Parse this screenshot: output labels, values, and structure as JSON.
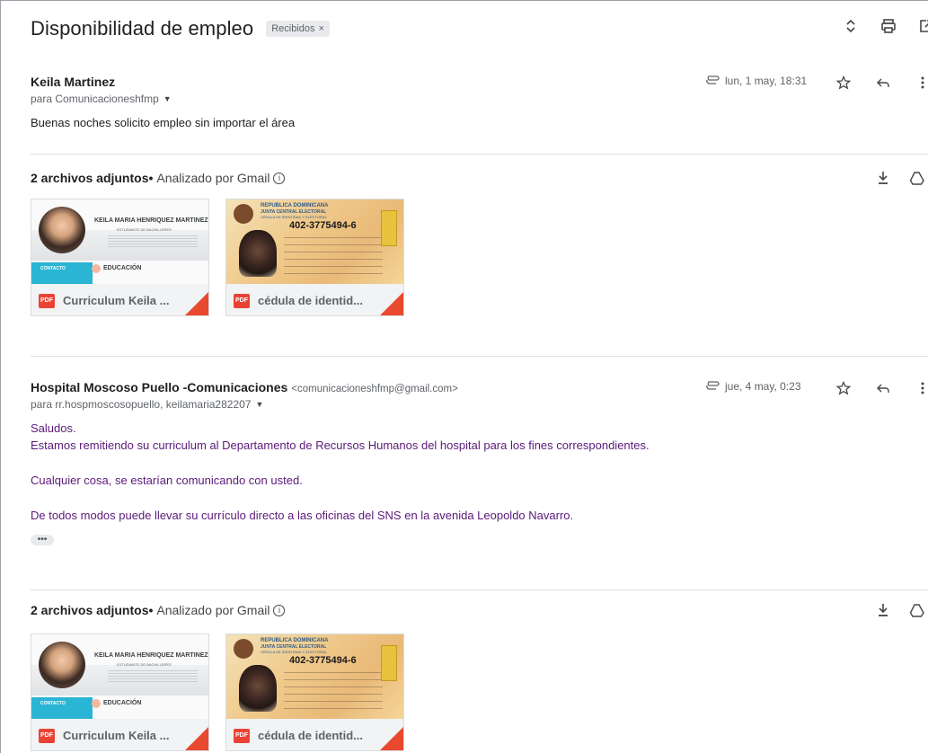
{
  "subject": "Disponibilidad de empleo",
  "label_chip": "Recibidos",
  "label_chip_close": "×",
  "top_icons": [
    "expand-collapse-icon",
    "print-icon",
    "open-new-window-icon"
  ],
  "messages": [
    {
      "sender": "Keila Martinez",
      "sender_email": "",
      "to": "para Comunicacioneshfmp",
      "date": "lun, 1 may, 18:31",
      "body": [
        "Buenas noches solicito empleo sin importar el área"
      ],
      "attachments_title": "2 archivos adjuntos",
      "attachments_note": "Analizado por Gmail",
      "attachments": [
        {
          "name": "Curriculum Keila ...",
          "type": "PDF"
        },
        {
          "name": "cédula de identid...",
          "type": "PDF"
        }
      ]
    },
    {
      "sender": "Hospital Moscoso Puello -Comunicaciones",
      "sender_email": "<comunicacioneshfmp@gmail.com>",
      "to": "para rr.hospmoscosopuello, keilamaria282207",
      "date": "jue, 4 may, 0:23",
      "body": [
        "Saludos.",
        "Estamos remitiendo su curriculum al Departamento de Recursos Humanos del hospital para los fines correspondientes.",
        "Cualquier cosa, se estarían comunicando con usted.",
        "De todos modos puede llevar su currículo directo a las oficinas del SNS en la avenida Leopoldo Navarro."
      ],
      "attachments_title": "2 archivos adjuntos",
      "attachments_note": "Analizado por Gmail",
      "attachments": [
        {
          "name": "Curriculum Keila ...",
          "type": "PDF"
        },
        {
          "name": "cédula de identid...",
          "type": "PDF"
        }
      ]
    }
  ],
  "cv_preview": {
    "name": "KEILA MARIA HENRIQUEZ MARTINEZ",
    "subtitle": "ESTUDIANTE DE BACHILLERES",
    "contact": "CONTACTO",
    "education": "EDUCACIÓN"
  },
  "id_preview": {
    "line1": "REPUBLICA DOMINICANA",
    "line2": "JUNTA CENTRAL ELECTORAL",
    "line3": "CÉDULA DE IDENTIDAD Y ELECTORAL",
    "number": "402-3775494-6"
  },
  "colors": {
    "body_purple": "#5b1a7a",
    "pdf_red": "#ea4335",
    "chip_bg": "#e8eaed"
  }
}
